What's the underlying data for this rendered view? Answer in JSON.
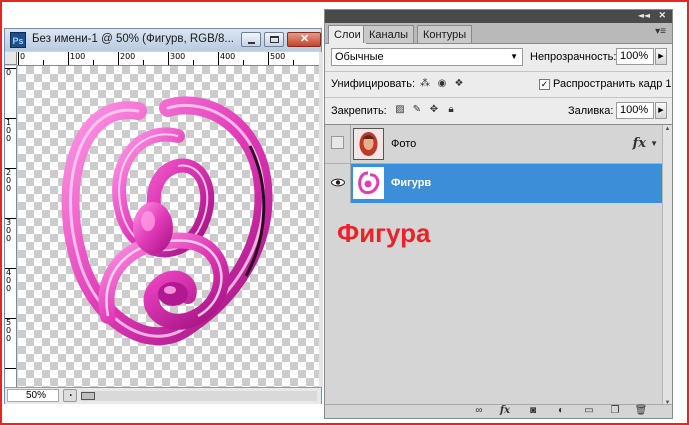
{
  "document": {
    "app_icon": "Ps",
    "title": "Без имени-1 @ 50% (Фигурв, RGB/8...",
    "zoom": "50%",
    "ruler_top": [
      "0",
      "100",
      "200",
      "300",
      "400",
      "500"
    ],
    "ruler_left": [
      "0",
      "1 0 0",
      "2 0 0",
      "3 0 0",
      "4 0 0",
      "5 0 0"
    ],
    "window_buttons": [
      "minimize-icon",
      "maximize-icon",
      "close-icon"
    ]
  },
  "panel": {
    "tabs": [
      {
        "label": "Слои",
        "active": true
      },
      {
        "label": "Каналы",
        "active": false
      },
      {
        "label": "Контуры",
        "active": false
      }
    ],
    "blend_mode": "Обычные",
    "opacity_label": "Непрозрачность:",
    "opacity_value": "100%",
    "unify_label": "Унифицировать:",
    "propagate_label": "Распространить кадр 1",
    "propagate_checked": true,
    "lock_label": "Закрепить:",
    "fill_label": "Заливка:",
    "fill_value": "100%",
    "layers": [
      {
        "name": "Фото",
        "visible": false,
        "selected": false,
        "has_fx": true
      },
      {
        "name": "Фигурв",
        "visible": true,
        "selected": true,
        "has_fx": false
      }
    ],
    "annotation": "Фигура",
    "footer_icons": [
      "link-icon",
      "fx-icon",
      "mask-icon",
      "adjustment-icon",
      "group-folder-icon",
      "new-layer-icon",
      "trash-icon"
    ]
  },
  "colors": {
    "frame": "#e8232a",
    "selection": "#3d8ed8",
    "figure": "#e23bb8"
  }
}
